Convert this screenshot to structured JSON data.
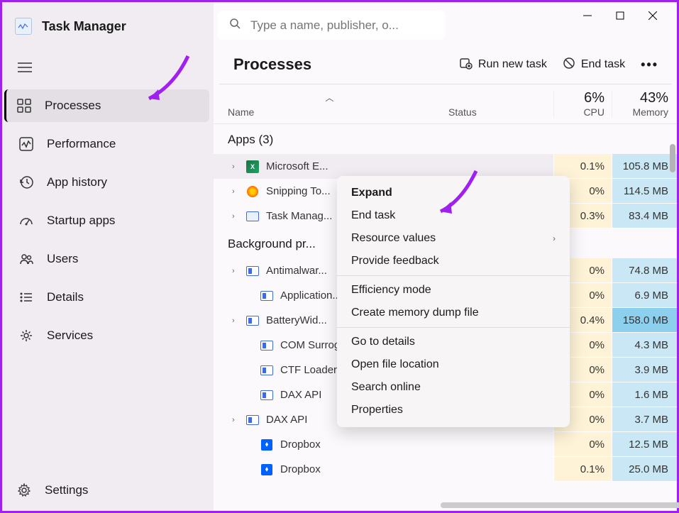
{
  "app": {
    "title": "Task Manager"
  },
  "search": {
    "placeholder": "Type a name, publisher, o..."
  },
  "sidebar": {
    "items": [
      {
        "label": "Processes"
      },
      {
        "label": "Performance"
      },
      {
        "label": "App history"
      },
      {
        "label": "Startup apps"
      },
      {
        "label": "Users"
      },
      {
        "label": "Details"
      },
      {
        "label": "Services"
      }
    ],
    "settings_label": "Settings"
  },
  "tab": {
    "title": "Processes",
    "actions": {
      "run_new_task": "Run new task",
      "end_task": "End task"
    }
  },
  "columns": {
    "name": "Name",
    "status": "Status",
    "cpu": {
      "percent": "6%",
      "label": "CPU"
    },
    "memory": {
      "percent": "43%",
      "label": "Memory"
    }
  },
  "groups": [
    {
      "label": "Apps (3)",
      "rows": [
        {
          "name": "Microsoft E...",
          "cpu": "0.1%",
          "memory": "105.8 MB",
          "expandable": true,
          "icon": "excel"
        },
        {
          "name": "Snipping To...",
          "cpu": "0%",
          "memory": "114.5 MB",
          "expandable": true,
          "icon": "snip"
        },
        {
          "name": "Task Manag...",
          "cpu": "0.3%",
          "memory": "83.4 MB",
          "expandable": true,
          "icon": "tm"
        }
      ]
    },
    {
      "label": "Background pr...",
      "rows": [
        {
          "name": "Antimalwar...",
          "cpu": "0%",
          "memory": "74.8 MB",
          "expandable": true,
          "icon": "generic"
        },
        {
          "name": "Application...",
          "cpu": "0%",
          "memory": "6.9 MB",
          "expandable": false,
          "icon": "generic",
          "indent": true
        },
        {
          "name": "BatteryWid...",
          "cpu": "0.4%",
          "memory": "158.0 MB",
          "expandable": true,
          "icon": "generic",
          "highlight": true
        },
        {
          "name": "COM Surrog...",
          "cpu": "0%",
          "memory": "4.3 MB",
          "expandable": false,
          "icon": "generic",
          "indent": true
        },
        {
          "name": "CTF Loader",
          "cpu": "0%",
          "memory": "3.9 MB",
          "expandable": false,
          "icon": "generic",
          "indent": true
        },
        {
          "name": "DAX API",
          "cpu": "0%",
          "memory": "1.6 MB",
          "expandable": false,
          "icon": "generic",
          "indent": true
        },
        {
          "name": "DAX API",
          "cpu": "0%",
          "memory": "3.7 MB",
          "expandable": true,
          "icon": "generic"
        },
        {
          "name": "Dropbox",
          "cpu": "0%",
          "memory": "12.5 MB",
          "expandable": false,
          "icon": "dropbox",
          "indent": true
        },
        {
          "name": "Dropbox",
          "cpu": "0.1%",
          "memory": "25.0 MB",
          "expandable": false,
          "icon": "dropbox",
          "indent": true
        }
      ]
    }
  ],
  "context_menu": {
    "items": [
      {
        "label": "Expand",
        "bold": true
      },
      {
        "label": "End task"
      },
      {
        "label": "Resource values",
        "submenu": true
      },
      {
        "label": "Provide feedback"
      },
      {
        "sep": true
      },
      {
        "label": "Efficiency mode"
      },
      {
        "label": "Create memory dump file"
      },
      {
        "sep": true
      },
      {
        "label": "Go to details"
      },
      {
        "label": "Open file location"
      },
      {
        "label": "Search online"
      },
      {
        "label": "Properties"
      }
    ]
  }
}
